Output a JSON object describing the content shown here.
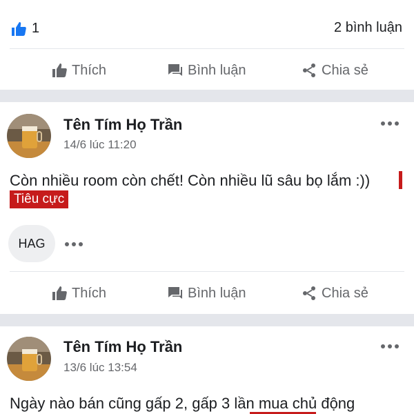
{
  "top_reactions": {
    "like_count": "1",
    "comment_count": "2 bình luận"
  },
  "actions": {
    "like": "Thích",
    "comment": "Bình luận",
    "share": "Chia sẻ"
  },
  "posts": [
    {
      "author": "Tên Tím Họ Trần",
      "time": "14/6 lúc 11:20",
      "text": "Còn nhiều room còn chết! Còn nhiều lũ sâu bọ lắm :))",
      "sentiment": "Tiêu cực",
      "tag": "HAG"
    },
    {
      "author": "Tên Tím Họ Trần",
      "time": "13/6 lúc 13:54",
      "text": "Ngày nào bán cũng gấp 2, gấp 3 lần mua chủ động"
    }
  ],
  "colors": {
    "like_blue": "#1877f2",
    "sentiment_red": "#c61b1b",
    "muted": "#65676b"
  },
  "icons": [
    "like-reaction-icon",
    "thumbs-up-icon",
    "comment-icon",
    "share-icon",
    "more-icon"
  ]
}
